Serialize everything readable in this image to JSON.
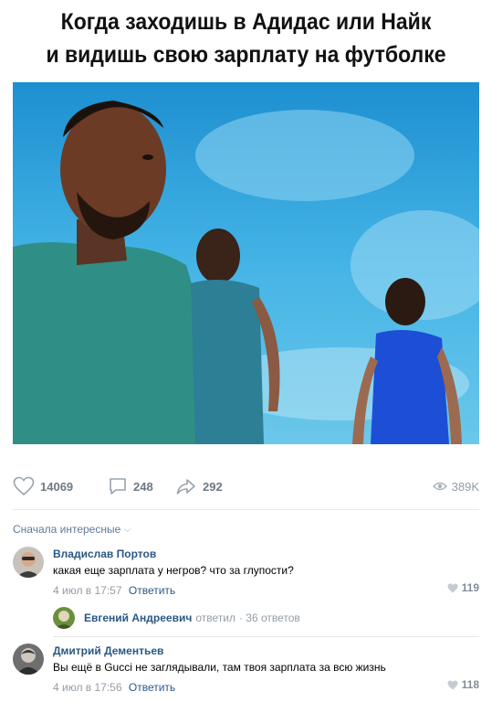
{
  "meme": {
    "title_line1": "Когда заходишь в Адидас или Найк",
    "title_line2": "и видишь свою зарплату на футболке"
  },
  "actions": {
    "likes": "14069",
    "comments": "248",
    "shares": "292",
    "views": "389K"
  },
  "comments_sort": {
    "label": "Сначала интересные",
    "chevron": "⌵"
  },
  "comments": [
    {
      "author": "Владислав Портов",
      "text": "какая еще зарплата у негров? что за глупости?",
      "date": "4 июл в 17:57",
      "reply_label": "Ответить",
      "likes": "119",
      "replies": {
        "author": "Евгений Андреевич",
        "verb": "ответил",
        "count": "· 36 ответов"
      }
    },
    {
      "author": "Дмитрий Дементьев",
      "text": "Вы ещё в Gucci не заглядывали, там твоя зарплата за всю жизнь",
      "date": "4 июл в 17:56",
      "reply_label": "Ответить",
      "likes": "118"
    }
  ],
  "colors": {
    "link": "#2a5885",
    "muted": "#939ca6",
    "icon": "#99a2ad"
  }
}
